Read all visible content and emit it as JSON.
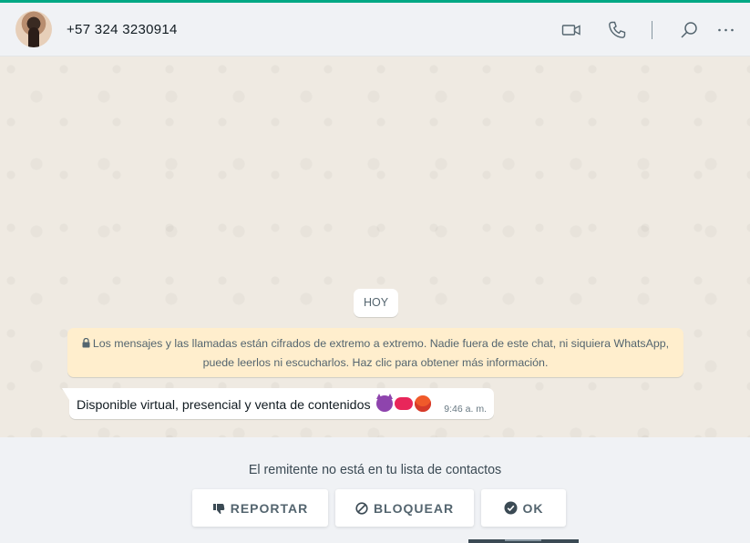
{
  "header": {
    "contact_name": "+57 324 3230914",
    "icons": [
      "video-call-icon",
      "voice-call-icon",
      "search-icon",
      "menu-icon"
    ]
  },
  "chat": {
    "day_label": "HOY",
    "encryption_notice_line1": "Los mensajes y las llamadas están cifrados de extremo a extremo. Nadie fuera de este chat, ni siquiera WhatsApp,",
    "encryption_notice_line2": "puede leerlos ni escucharlos. Haz clic para obtener más información.",
    "messages": [
      {
        "text": "Disponible virtual, presencial y venta de contenidos",
        "emojis": [
          "smiling-devil-emoji",
          "kiss-mark-emoji",
          "hot-face-emoji"
        ],
        "time": "9:46 a. m."
      }
    ]
  },
  "footer": {
    "notice": "El remitente no está en tu lista de contactos",
    "report_label": "REPORTAR",
    "block_label": "BLOQUEAR",
    "ok_label": "OK"
  },
  "colors": {
    "accent": "#00a884",
    "chat_background": "#efeae2",
    "notice_background": "#ffeecd",
    "icon_gray": "#54656f"
  }
}
